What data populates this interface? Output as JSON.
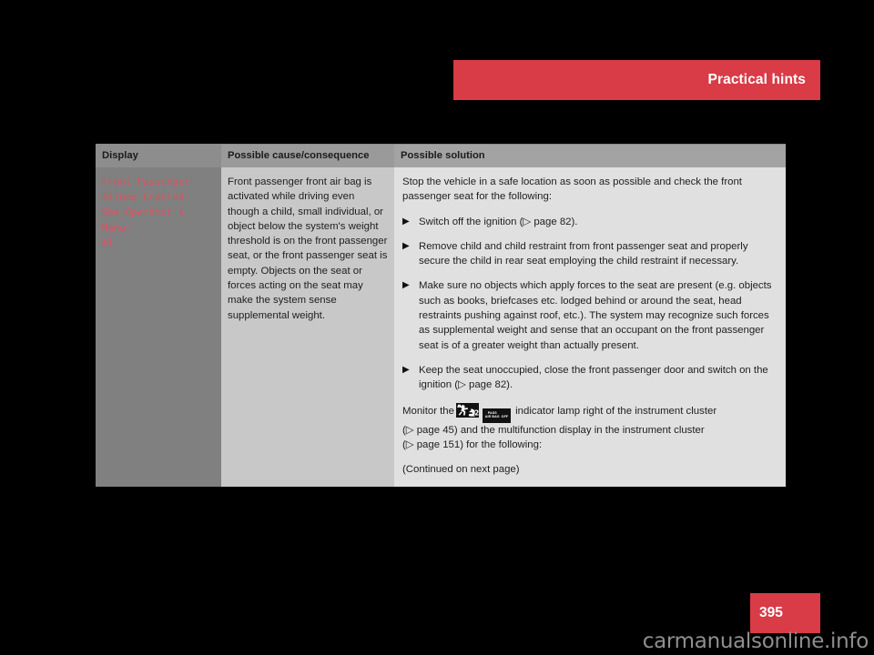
{
  "header": {
    "title": "Practical hints",
    "accent_color": "#d93b47"
  },
  "table": {
    "columns": [
      {
        "header": "Display"
      },
      {
        "header": "Possible cause/consequence"
      },
      {
        "header": "Possible solution"
      }
    ],
    "row": {
      "display_message": "Front Passenger\nAirbag Enabled\nSee Operator's Manu-\nal",
      "display_text_color": "#e0505c",
      "cause": "Front passenger front air bag is activated while driving even though a child, small individual, or object below the system's weight threshold is on the front passenger seat, or the front passenger seat is empty. Objects on the seat or forces acting on the seat may make the system sense supplemental weight.",
      "solution": {
        "intro": "Stop the vehicle in a safe location as soon as possible and check the front passenger seat for the following:",
        "bullets": [
          "Switch off the ignition (▷ page 82).",
          "Remove child and child restraint from front passenger seat and properly secure the child in rear seat employing the child restraint if necessary.",
          "Make sure no objects which apply forces to the seat are present (e.g. objects such as books, briefcases etc. lodged behind or around the seat, head restraints pushing against roof, etc.). The system may recognize such forces as supplemental weight and sense that an occupant on the front passenger seat is of a greater weight than actually present.",
          "Keep the seat unoccupied, close the front passenger door and switch on the ignition (▷ page 82)."
        ],
        "bullet_marker": "▶",
        "monitor_pre": "Monitor the",
        "monitor_post": "indicator lamp right of the instrument cluster",
        "monitor_line2": "(▷ page 45) and the multifunction display in the instrument cluster",
        "monitor_line3": "(▷ page 151) for the following:",
        "continued": "(Continued on next page)",
        "lamp_icons": [
          {
            "name": "child-seat-airbag-icon",
            "label": ""
          },
          {
            "name": "pass-air-bag-off-icon",
            "line1": "PASS",
            "line2": "AIR BAG",
            "suffix": "OFF"
          }
        ]
      }
    }
  },
  "footer": {
    "page_number": "395",
    "watermark": "carmanualsonline.info"
  }
}
